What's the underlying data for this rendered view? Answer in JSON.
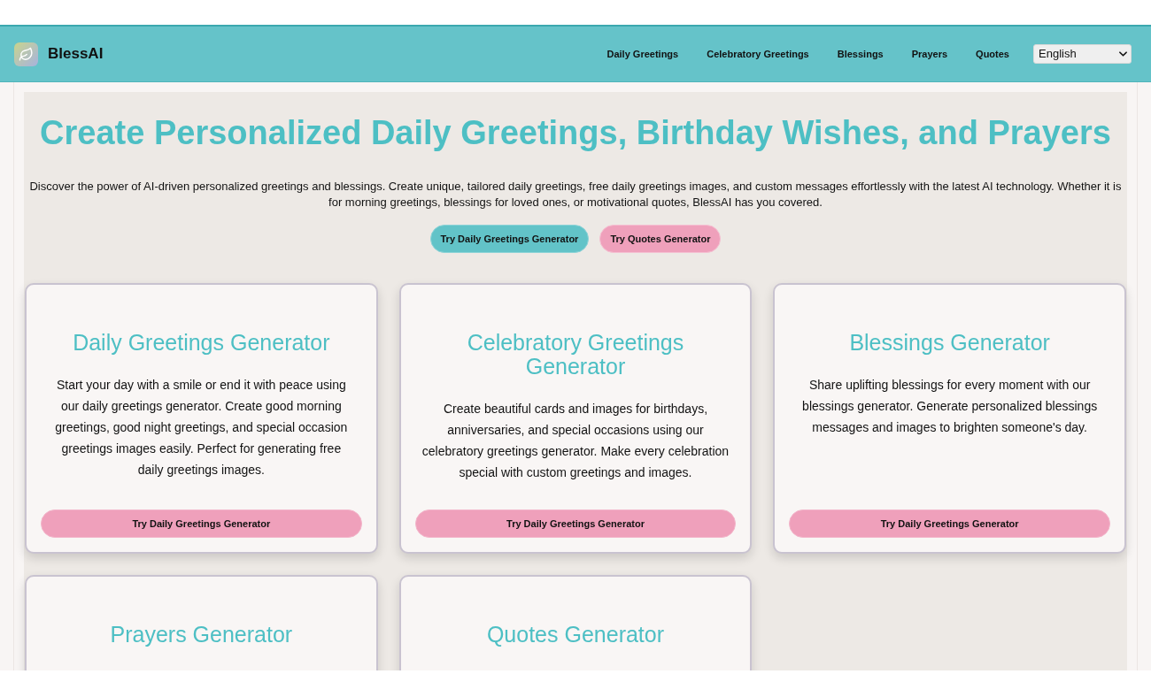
{
  "header": {
    "brand": "BlessAI",
    "nav": [
      "Daily Greetings",
      "Celebratory Greetings",
      "Blessings",
      "Prayers",
      "Quotes"
    ],
    "language": "English"
  },
  "hero": {
    "title": "Create Personalized Daily Greetings, Birthday Wishes, and Prayers",
    "description": "Discover the power of AI-driven personalized greetings and blessings. Create unique, tailored daily greetings, free daily greetings images, and custom messages effortlessly with the latest AI technology. Whether it is for morning greetings, blessings for loved ones, or motivational quotes, BlessAI has you covered.",
    "buttons": [
      {
        "label": "Try Daily Greetings Generator",
        "kind": "primary"
      },
      {
        "label": "Try Quotes Generator",
        "kind": "secondary"
      }
    ]
  },
  "cards": [
    {
      "title": "Daily Greetings Generator",
      "description": "Start your day with a smile or end it with peace using our daily greetings generator. Create good morning greetings, good night greetings, and special occasion greetings images easily. Perfect for generating free daily greetings images.",
      "button": "Try Daily Greetings Generator"
    },
    {
      "title": "Celebratory Greetings Generator",
      "description": "Create beautiful cards and images for birthdays, anniversaries, and special occasions using our celebratory greetings generator. Make every celebration special with custom greetings and images.",
      "button": "Try Daily Greetings Generator"
    },
    {
      "title": "Blessings Generator",
      "description": "Share uplifting blessings for every moment with our blessings generator. Generate personalized blessings messages and images to brighten someone's day.",
      "button": "Try Daily Greetings Generator"
    },
    {
      "title": "Prayers Generator"
    },
    {
      "title": "Quotes Generator"
    }
  ]
}
